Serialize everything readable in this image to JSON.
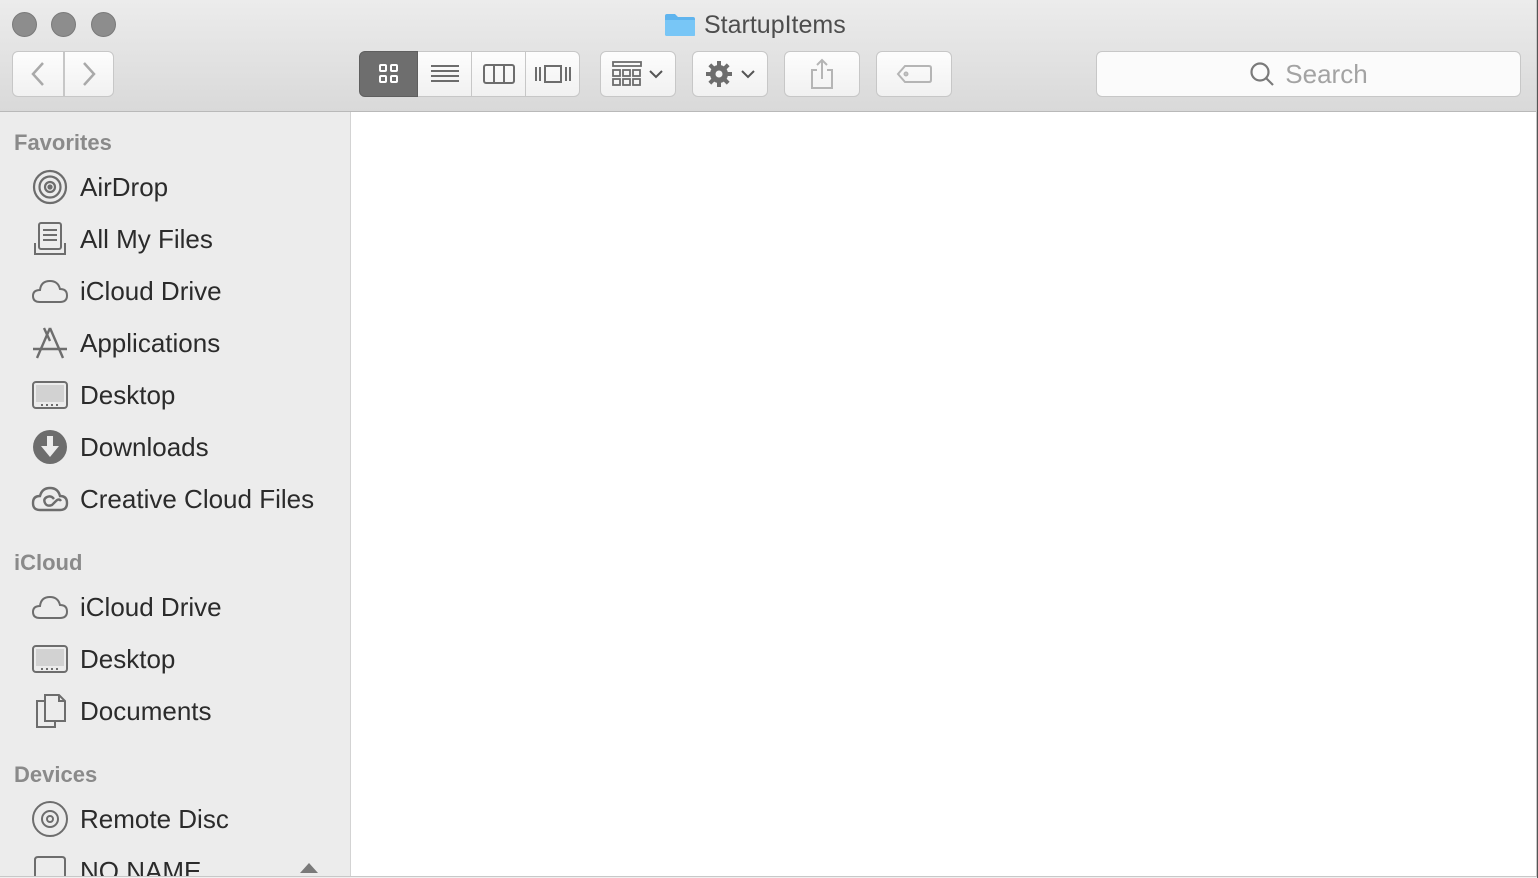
{
  "window": {
    "title": "StartupItems"
  },
  "toolbar": {
    "back_label": "Back",
    "forward_label": "Forward",
    "view_modes": [
      "icon-view",
      "list-view",
      "column-view",
      "cover-flow-view"
    ],
    "active_view": "icon-view",
    "search_placeholder": "Search"
  },
  "sidebar": {
    "favorites": {
      "title": "Favorites",
      "items": [
        {
          "label": "AirDrop",
          "icon": "airdrop-icon"
        },
        {
          "label": "All My Files",
          "icon": "all-my-files-icon"
        },
        {
          "label": "iCloud Drive",
          "icon": "cloud-icon"
        },
        {
          "label": "Applications",
          "icon": "applications-icon"
        },
        {
          "label": "Desktop",
          "icon": "desktop-icon"
        },
        {
          "label": "Downloads",
          "icon": "downloads-icon"
        },
        {
          "label": "Creative Cloud Files",
          "icon": "creative-cloud-icon"
        }
      ]
    },
    "icloud": {
      "title": "iCloud",
      "items": [
        {
          "label": "iCloud Drive",
          "icon": "cloud-icon"
        },
        {
          "label": "Desktop",
          "icon": "desktop-icon"
        },
        {
          "label": "Documents",
          "icon": "documents-icon"
        }
      ]
    },
    "devices": {
      "title": "Devices",
      "items": [
        {
          "label": "Remote Disc",
          "icon": "disc-icon"
        },
        {
          "label": "NO NAME",
          "icon": "drive-icon"
        }
      ]
    }
  },
  "colors": {
    "accent": "#4a9de6",
    "icon_gray": "#6d6d6d"
  }
}
